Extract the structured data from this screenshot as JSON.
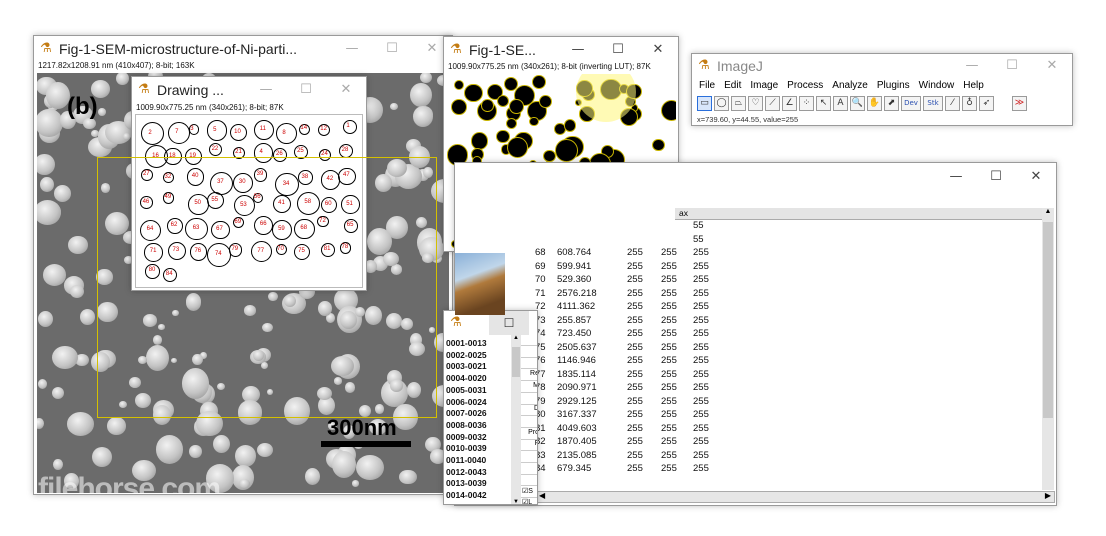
{
  "sem_window": {
    "title": "Fig-1-SEM-microstructure-of-Ni-parti...",
    "info": "1217.82x1208.91 nm (410x407); 8-bit; 163K",
    "panel_label": "(b)",
    "scale_label": "300nm",
    "watermark": "filehorse.com",
    "minimize": "—",
    "maximize": "☐",
    "close": "✕"
  },
  "drawing_window": {
    "title": "Drawing ...",
    "info": "1009.90x775.25 nm (340x261); 8-bit; 87K",
    "labels": [
      "2",
      "7",
      "3",
      "5",
      "10",
      "11",
      "8",
      "14",
      "12",
      "1",
      "16",
      "18",
      "19",
      "22",
      "21",
      "4",
      "26",
      "25",
      "24",
      "28",
      "27",
      "32",
      "40",
      "37",
      "30",
      "39",
      "34",
      "38",
      "42",
      "47",
      "46",
      "49",
      "50",
      "55",
      "53",
      "56",
      "41",
      "58",
      "60",
      "51",
      "64",
      "62",
      "63",
      "67",
      "69",
      "66",
      "59",
      "68",
      "72",
      "65",
      "71",
      "73",
      "76",
      "74",
      "79",
      "77",
      "70",
      "75",
      "81",
      "78",
      "80",
      "84"
    ],
    "minimize": "—",
    "maximize": "☐",
    "close": "✕"
  },
  "mask_window": {
    "title": "Fig-1-SE...",
    "info": "1009.90x775.25 nm (340x261); 8-bit (inverting LUT); 87K",
    "minimize": "—",
    "maximize": "☐",
    "close": "✕"
  },
  "imagej_window": {
    "title": "ImageJ",
    "menu": [
      "File",
      "Edit",
      "Image",
      "Process",
      "Analyze",
      "Plugins",
      "Window",
      "Help"
    ],
    "tools": [
      "rectangle-tool",
      "oval-tool",
      "polygon-tool",
      "freehand-tool",
      "line-tool",
      "angle-tool",
      "point-tool",
      "wand-tool",
      "text-tool",
      "magnifier-tool",
      "hand-tool",
      "color-picker-tool",
      "dev-tool",
      "stk-tool",
      "brush-tool",
      "flood-fill-tool",
      "arrow-tool",
      "more-tools"
    ],
    "tool_glyphs": [
      "▭",
      "◯",
      "⏢",
      "♡",
      "⟋",
      "∠",
      "⁘",
      "↖",
      "A",
      "🔍",
      "✋",
      "⬈",
      "Dev",
      "Stk",
      "⁄",
      "♁",
      "➶",
      "≫"
    ],
    "status": "x=739.60, y=44.55, value=255",
    "minimize": "—",
    "maximize": "☐",
    "close": "✕"
  },
  "results_window": {
    "col_header_last": "ax",
    "rows": [
      {
        "n": "",
        "area": "",
        "min": "",
        "max": "",
        "last": "55"
      },
      {
        "n": "",
        "area": "",
        "min": "",
        "max": "",
        "last": "55"
      },
      {
        "n": "68",
        "area": "608.764",
        "min": "255",
        "max": "255",
        "last": "255"
      },
      {
        "n": "69",
        "area": "599.941",
        "min": "255",
        "max": "255",
        "last": "255"
      },
      {
        "n": "70",
        "area": "529.360",
        "min": "255",
        "max": "255",
        "last": "255"
      },
      {
        "n": "71",
        "area": "2576.218",
        "min": "255",
        "max": "255",
        "last": "255"
      },
      {
        "n": "72",
        "area": "4111.362",
        "min": "255",
        "max": "255",
        "last": "255"
      },
      {
        "n": "73",
        "area": "255.857",
        "min": "255",
        "max": "255",
        "last": "255"
      },
      {
        "n": "74",
        "area": "723.450",
        "min": "255",
        "max": "255",
        "last": "255"
      },
      {
        "n": "75",
        "area": "2505.637",
        "min": "255",
        "max": "255",
        "last": "255"
      },
      {
        "n": "76",
        "area": "1146.946",
        "min": "255",
        "max": "255",
        "last": "255"
      },
      {
        "n": "77",
        "area": "1835.114",
        "min": "255",
        "max": "255",
        "last": "255"
      },
      {
        "n": "78",
        "area": "2090.971",
        "min": "255",
        "max": "255",
        "last": "255"
      },
      {
        "n": "79",
        "area": "2929.125",
        "min": "255",
        "max": "255",
        "last": "255"
      },
      {
        "n": "80",
        "area": "3167.337",
        "min": "255",
        "max": "255",
        "last": "255"
      },
      {
        "n": "81",
        "area": "4049.603",
        "min": "255",
        "max": "255",
        "last": "255"
      },
      {
        "n": "82",
        "area": "1870.405",
        "min": "255",
        "max": "255",
        "last": "255"
      },
      {
        "n": "83",
        "area": "2135.085",
        "min": "255",
        "max": "255",
        "last": "255"
      },
      {
        "n": "84",
        "area": "679.345",
        "min": "255",
        "max": "255",
        "last": "255"
      }
    ],
    "minimize": "—",
    "maximize": "☐",
    "close": "✕"
  },
  "roi_window": {
    "maximize": "☐",
    "items": [
      "0001-0013",
      "0002-0025",
      "0003-0021",
      "0004-0020",
      "0005-0031",
      "0006-0024",
      "0007-0026",
      "0008-0036",
      "0009-0032",
      "0010-0039",
      "0011-0040",
      "0012-0043",
      "0013-0039",
      "0014-0042"
    ],
    "side_buttons": [
      "",
      "",
      "",
      "Re",
      "M",
      "",
      "D",
      "",
      "Pro",
      "F",
      "",
      "",
      "",
      ""
    ],
    "checkbox_labels": [
      "S",
      "L"
    ]
  },
  "colors": {
    "accent": "#c8b400",
    "sem_bg": "#6e6e6e",
    "label_red": "#cc0000"
  }
}
